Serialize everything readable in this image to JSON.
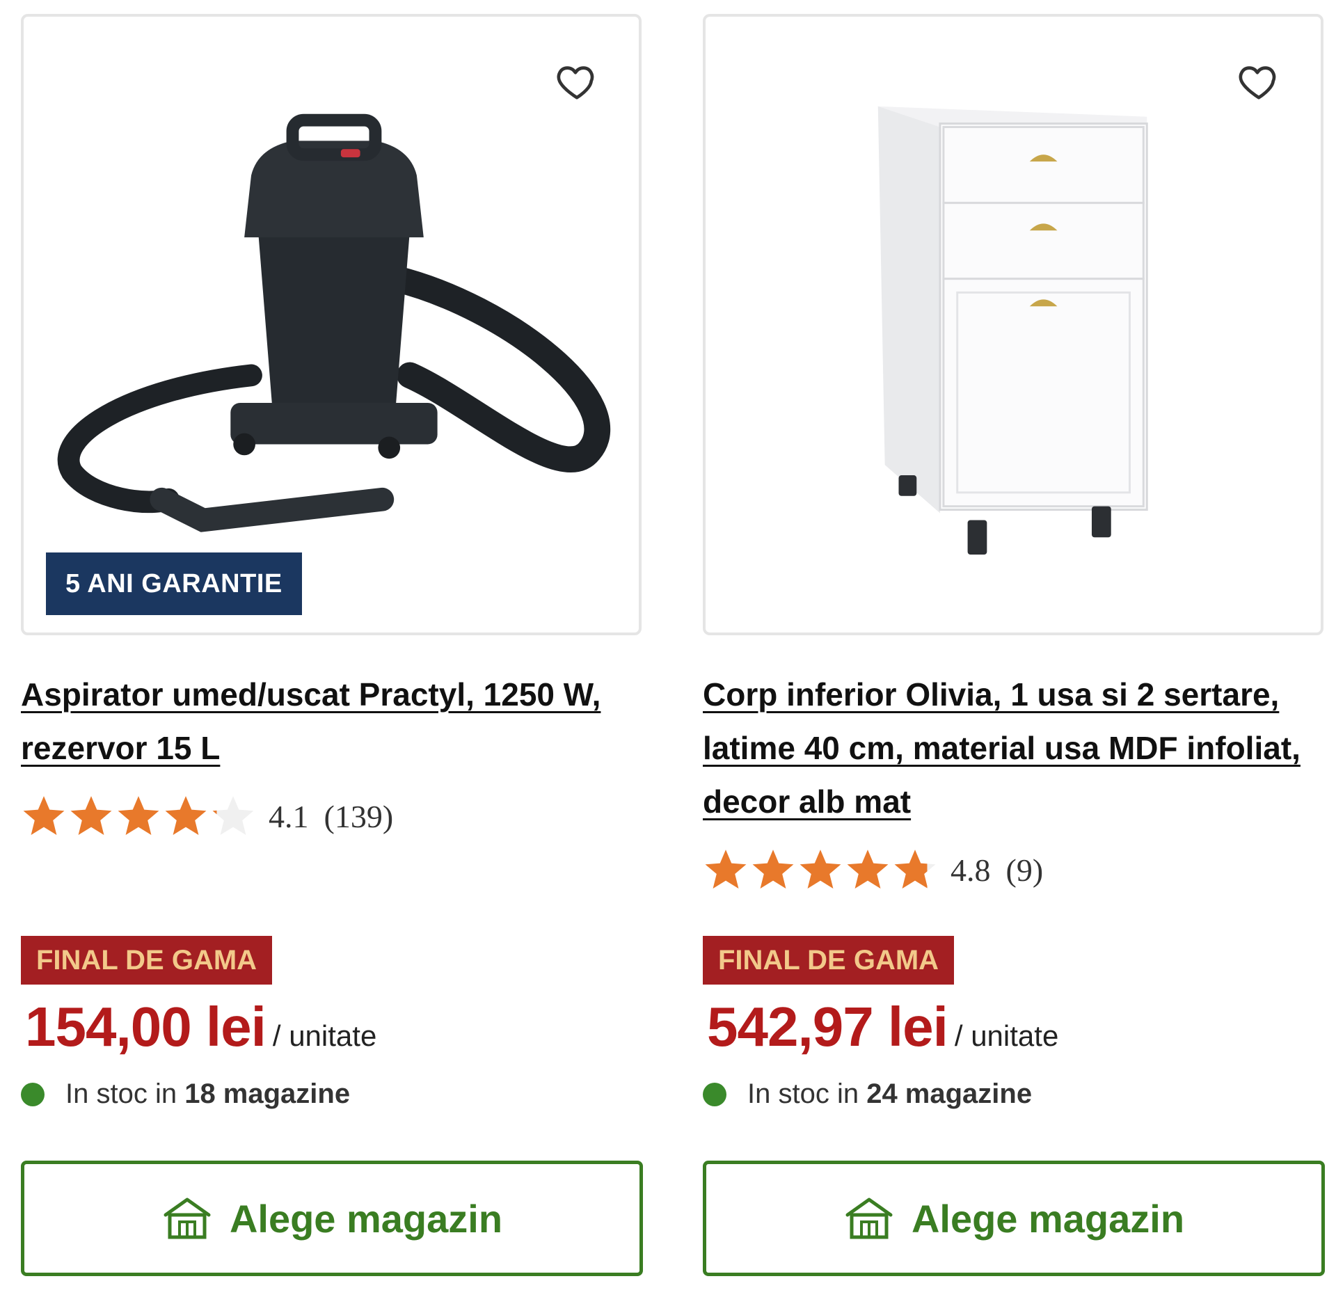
{
  "products": [
    {
      "warranty_badge": "5 ANI GARANTIE",
      "title": "Aspirator umed/uscat Practyl, 1250 W, rezervor 15 L",
      "rating": "4.1",
      "rating_count": "(139)",
      "rating_value": 4.1,
      "promo_badge": "FINAL DE GAMA",
      "price": "154,00 lei",
      "price_unit": "/ unitate",
      "stock_prefix": "In stoc in ",
      "stock_count": "18 magazine",
      "store_button": "Alege magazin"
    },
    {
      "title": "Corp inferior Olivia, 1 usa si 2 sertare, latime 40 cm, material usa MDF infoliat, decor alb mat",
      "rating": "4.8",
      "rating_count": "(9)",
      "rating_value": 4.8,
      "promo_badge": "FINAL DE GAMA",
      "price": "542,97 lei",
      "price_unit": "/ unitate",
      "stock_prefix": "In stoc in ",
      "stock_count": "24 magazine",
      "store_button": "Alege magazin"
    }
  ],
  "colors": {
    "star": "#e8792b",
    "star_empty": "#f0f0f0",
    "price": "#b31b1b",
    "accent_green": "#3a7d22",
    "warranty_bg": "#1b3760",
    "promo_bg": "#a31f22"
  },
  "icons": [
    "heart-icon",
    "star-icon",
    "store-icon"
  ]
}
